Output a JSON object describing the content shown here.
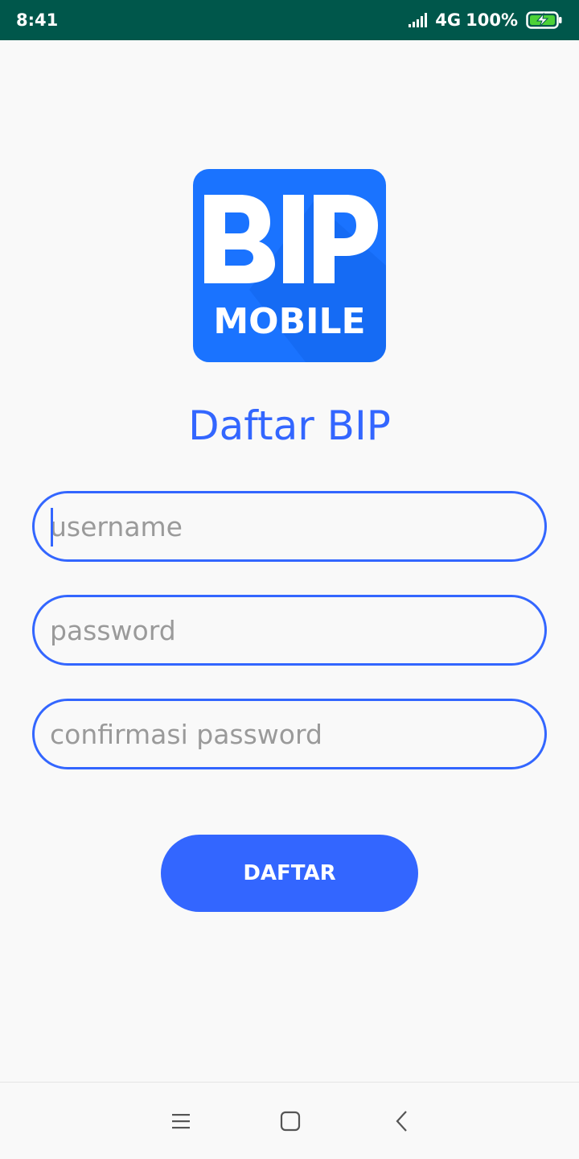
{
  "status_bar": {
    "time": "8:41",
    "network": "4G",
    "battery": "100%",
    "background_color": "#00574b"
  },
  "logo": {
    "line1": "BIP",
    "line2": "MOBILE",
    "color": "#1a73ff"
  },
  "page_title": "Daftar BIP",
  "form": {
    "username_placeholder": "username",
    "password_placeholder": "password",
    "confirm_password_placeholder": "confirmasi password",
    "submit_label": "DAFTAR"
  },
  "accent_color": "#3366ff",
  "nav_bar": {
    "icons": [
      "menu-icon",
      "home-square-icon",
      "back-icon"
    ]
  }
}
